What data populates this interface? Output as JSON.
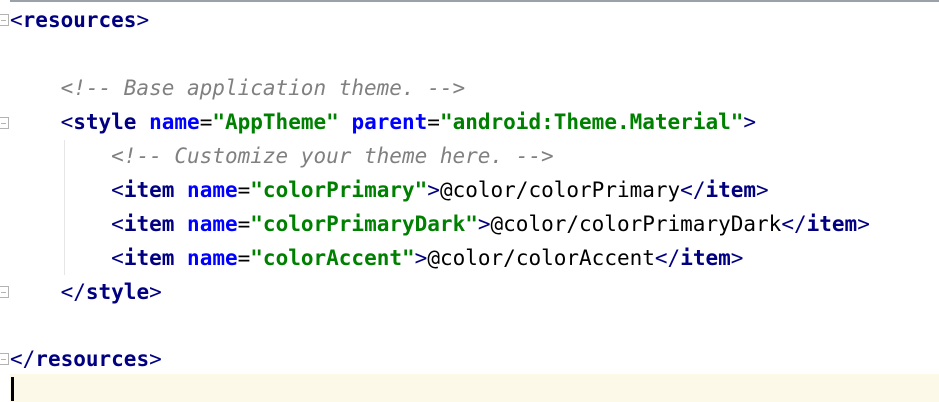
{
  "editor": {
    "lines": [
      {
        "open": "<",
        "tag": "resources",
        "close": ">"
      },
      {
        "comment": "<!-- Base application theme. -->"
      },
      {
        "open": "<",
        "tag": "style",
        "attr1": "name",
        "eq1": "=",
        "val1": "\"AppTheme\"",
        "attr2": "parent",
        "eq2": "=",
        "val2": "\"android:Theme.Material\"",
        "close": ">"
      },
      {
        "comment": "<!-- Customize your theme here. -->"
      },
      {
        "open": "<",
        "tag": "item",
        "attr": "name",
        "eq": "=",
        "val": "\"colorPrimary\"",
        "gt": ">",
        "text": "@color/colorPrimary",
        "endopen": "</",
        "endtag": "item",
        "close": ">"
      },
      {
        "open": "<",
        "tag": "item",
        "attr": "name",
        "eq": "=",
        "val": "\"colorPrimaryDark\"",
        "gt": ">",
        "text": "@color/colorPrimaryDark",
        "endopen": "</",
        "endtag": "item",
        "close": ">"
      },
      {
        "open": "<",
        "tag": "item",
        "attr": "name",
        "eq": "=",
        "val": "\"colorAccent\"",
        "gt": ">",
        "text": "@color/colorAccent",
        "endopen": "</",
        "endtag": "item",
        "close": ">"
      },
      {
        "open": "</",
        "tag": "style",
        "close": ">"
      },
      {
        "open": "</",
        "tag": "resources",
        "close": ">"
      }
    ]
  },
  "colors": {
    "tag": "#000080",
    "attribute": "#0000ff",
    "value": "#008000",
    "comment": "#808080",
    "current_line": "#fdf9e8"
  }
}
